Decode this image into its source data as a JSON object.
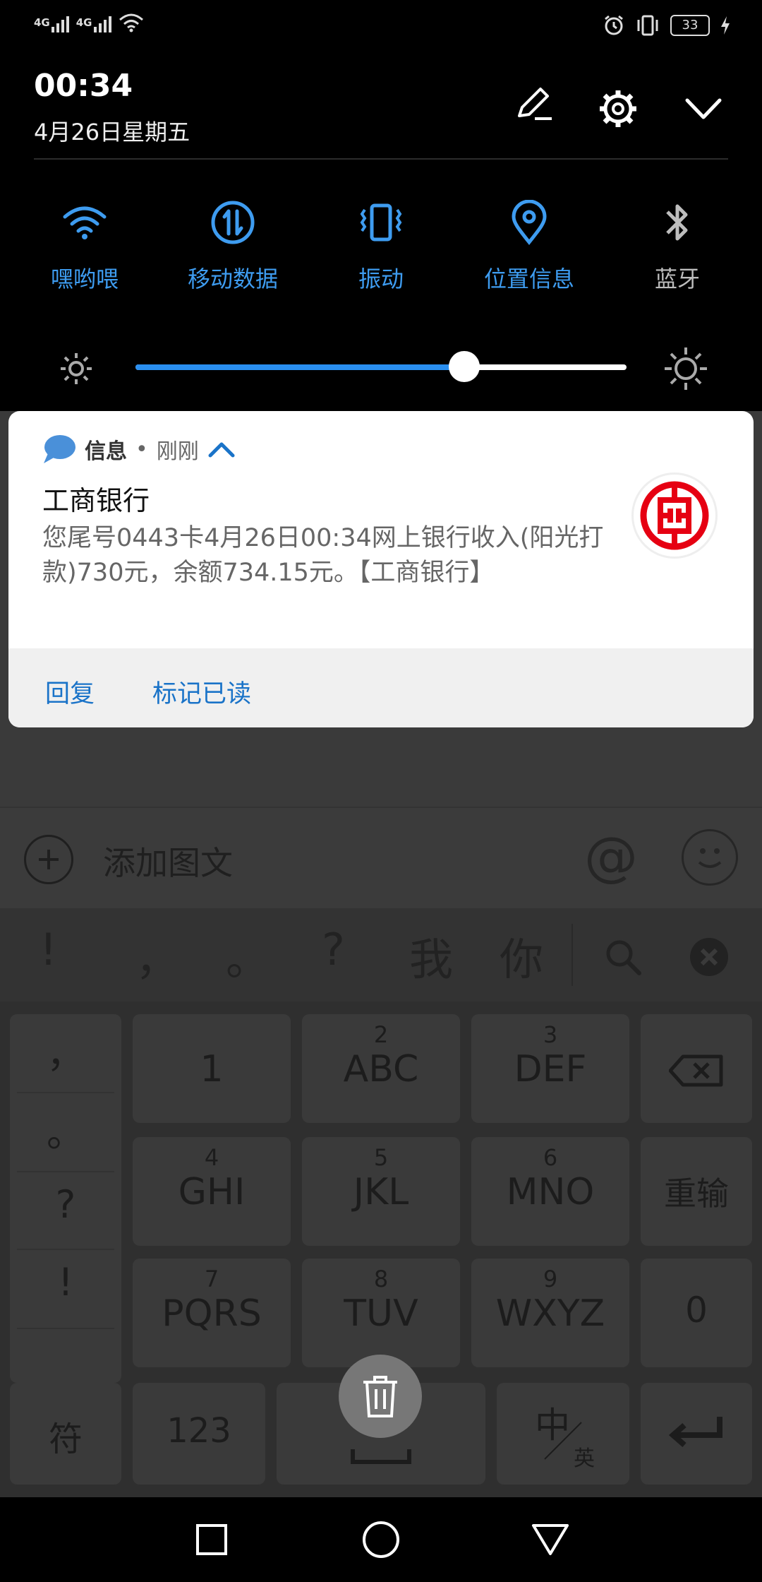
{
  "status_bar": {
    "sim1": "4G",
    "sim2": "4G",
    "battery": "33",
    "icons": [
      "signal-icon",
      "signal-icon",
      "wifi-icon",
      "alarm-icon",
      "vibrate-icon",
      "battery-icon",
      "charging-icon"
    ]
  },
  "header": {
    "time": "00:34",
    "date": "4月26日星期五"
  },
  "quick_tiles": [
    {
      "label": "嘿哟喂",
      "icon": "wifi-icon",
      "active": true
    },
    {
      "label": "移动数据",
      "icon": "mobile-data-icon",
      "active": true
    },
    {
      "label": "振动",
      "icon": "vibrate-icon",
      "active": true
    },
    {
      "label": "位置信息",
      "icon": "location-icon",
      "active": true
    },
    {
      "label": "蓝牙",
      "icon": "bluetooth-icon",
      "active": false
    }
  ],
  "brightness": {
    "level": 0.67
  },
  "notification": {
    "app": "信息",
    "separator": "•",
    "time": "刚刚",
    "title": "工商银行",
    "body": "您尾号0443卡4月26日00:34网上银行收入(阳光打款)730元，余额734.15元。【工商银行】",
    "actions": [
      "回复",
      "标记已读"
    ]
  },
  "compose": {
    "placeholder": "添加图文"
  },
  "candidates": [
    "!",
    "，",
    "。",
    "?",
    "我",
    "你"
  ],
  "keyboard": {
    "punct_column": [
      "，",
      "。",
      "?",
      "!"
    ],
    "keys": [
      {
        "num": "",
        "label": "1"
      },
      {
        "num": "2",
        "label": "ABC"
      },
      {
        "num": "3",
        "label": "DEF"
      },
      {
        "num": "4",
        "label": "GHI"
      },
      {
        "num": "5",
        "label": "JKL"
      },
      {
        "num": "6",
        "label": "MNO"
      },
      {
        "num": "7",
        "label": "PQRS"
      },
      {
        "num": "8",
        "label": "TUV"
      },
      {
        "num": "9",
        "label": "WXYZ"
      }
    ],
    "reenter": "重输",
    "zero": "0",
    "symbols": "符",
    "numbers": "123",
    "lang_main": "中",
    "lang_sub": "英"
  },
  "colors": {
    "accent": "#2a8ff0",
    "tile_active": "#3e9cf0",
    "link": "#1a73c8",
    "icbc_red": "#e60012"
  }
}
